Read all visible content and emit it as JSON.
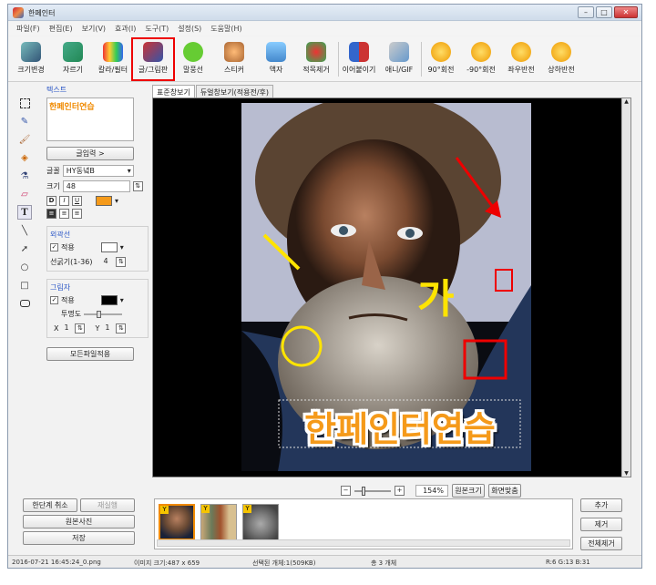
{
  "window": {
    "title": "한페인터"
  },
  "menu": [
    "파일(F)",
    "편집(E)",
    "보기(V)",
    "효과(I)",
    "도구(T)",
    "설정(S)",
    "도움말(H)"
  ],
  "toolbar": [
    {
      "label": "크기변경",
      "color": "#f4f4f4"
    },
    {
      "label": "자르기",
      "color": "#f4f4f4"
    },
    {
      "label": "칼라/필터",
      "color": "#f4f4f4"
    },
    {
      "label": "글/그림판",
      "color": "#f4f4f4"
    },
    {
      "label": "말풍선",
      "color": "#f4f4f4"
    },
    {
      "label": "스티커",
      "color": "#f4f4f4"
    },
    {
      "label": "액자",
      "color": "#f4f4f4"
    },
    {
      "label": "적목제거",
      "color": "#f4f4f4"
    },
    {
      "label": "이어붙이기",
      "color": "#f4f4f4"
    },
    {
      "label": "애니/GIF",
      "color": "#f4f4f4"
    },
    {
      "label": "90°회전",
      "color": "#f4f4f4"
    },
    {
      "label": "-90°회전",
      "color": "#f4f4f4"
    },
    {
      "label": "좌우반전",
      "color": "#f4f4f4"
    },
    {
      "label": "상하반전",
      "color": "#f4f4f4"
    }
  ],
  "text_panel": {
    "section_label": "텍스트",
    "text_value": "한페인터연습",
    "input_button": "글입력 >",
    "font_label": "글꼴",
    "font_value": "HY동녘B",
    "size_label": "크기",
    "size_value": "48",
    "text_color": "#f59a1a",
    "outline_label": "외곽선",
    "outline_apply": "적용",
    "outline_thickness_label": "선굵기(1-36)",
    "outline_thickness_value": "4",
    "shadow_label": "그림자",
    "shadow_apply": "적용",
    "shadow_color": "#000000",
    "transparency_label": "투명도",
    "x_label": "X",
    "x_value": "1",
    "y_label": "Y",
    "y_value": "1",
    "apply_all_button": "모든파일적용"
  },
  "view_tabs": [
    "표준창보기",
    "듀얼창보기(적용전/후)"
  ],
  "canvas": {
    "overlay_text": "한페인터연습",
    "handwritten_text": "가"
  },
  "zoom": {
    "value": "154%",
    "original_size": "원본크기",
    "fit_screen": "화면맞춤"
  },
  "bottom_left": {
    "undo": "한단계 취소",
    "redo": "재실행",
    "original": "원본사진",
    "save": "저장"
  },
  "bottom_right": {
    "add": "추가",
    "remove": "제거",
    "remove_all": "전체제거"
  },
  "status": {
    "filename": "2016-07-21 16:45:24_0.png",
    "image_info": "이미지 크기:487 x 659",
    "selection": "선택된 개체:1(509KB)",
    "total": "총 3 개체",
    "color": "R:6 G:13 B:31"
  }
}
